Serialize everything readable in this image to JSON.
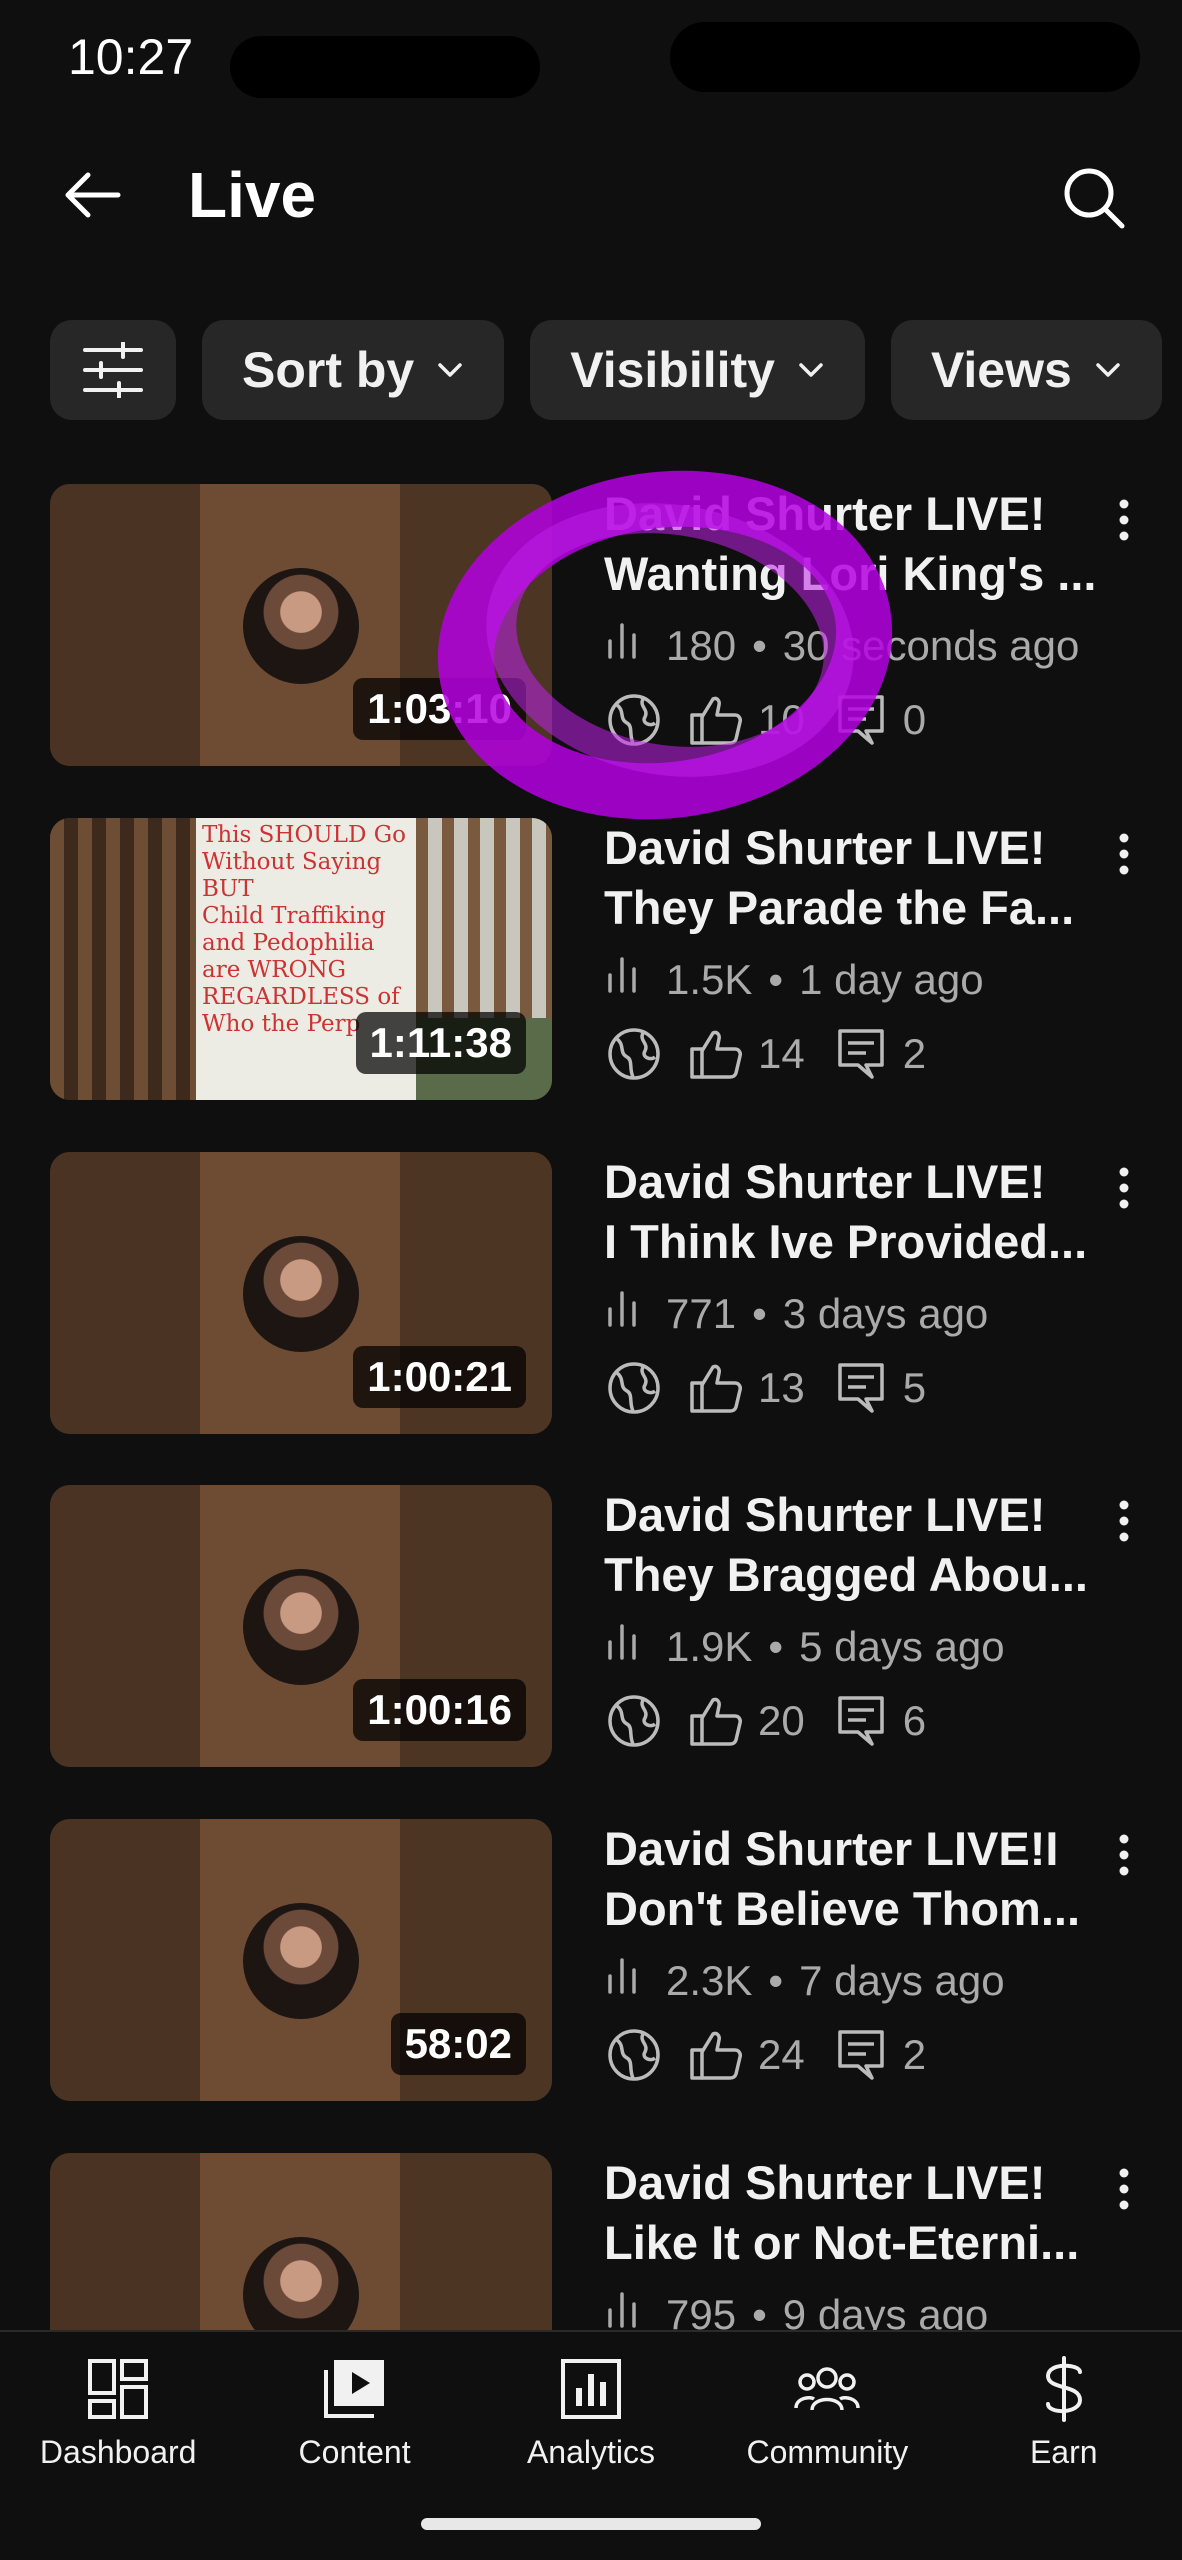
{
  "status_bar": {
    "time": "10:27"
  },
  "header": {
    "title": "Live",
    "back_icon": "arrow-left-icon",
    "search_icon": "search-icon"
  },
  "chips": [
    {
      "icon": "filter-sliders-icon"
    },
    {
      "label": "Sort by"
    },
    {
      "label": "Visibility"
    },
    {
      "label": "Views"
    }
  ],
  "videos": [
    {
      "title1": "David Shurter LIVE!",
      "title2": "Wanting Lori King's ...",
      "views": "180",
      "age": "30 seconds ago",
      "likes": "10",
      "comments": "0",
      "duration": "1:03:10"
    },
    {
      "title1": "David Shurter LIVE!",
      "title2": "They Parade the Fa...",
      "views": "1.5K",
      "age": "1 day ago",
      "likes": "14",
      "comments": "2",
      "duration": "1:11:38",
      "thumbnail_sign": [
        "This SHOULD Go",
        "Without Saying BUT",
        "Child Traffiking",
        "and Pedophilia",
        "are WRONG",
        "REGARDLESS of",
        "Who the Perp"
      ]
    },
    {
      "title1": "David Shurter LIVE!",
      "title2": "I Think Ive Provided...",
      "views": "771",
      "age": "3 days ago",
      "likes": "13",
      "comments": "5",
      "duration": "1:00:21"
    },
    {
      "title1": "David Shurter LIVE!",
      "title2": "They Bragged Abou...",
      "views": "1.9K",
      "age": "5 days ago",
      "likes": "20",
      "comments": "6",
      "duration": "1:00:16"
    },
    {
      "title1": "David Shurter LIVE!I",
      "title2": "Don't Believe Thom...",
      "views": "2.3K",
      "age": "7 days ago",
      "likes": "24",
      "comments": "2",
      "duration": "58:02"
    },
    {
      "title1": "David Shurter LIVE!",
      "title2": "Like It or Not-Eterni...",
      "views": "795",
      "age": "9 days ago"
    }
  ],
  "meta_separator": "•",
  "bottom_nav": [
    {
      "label": "Dashboard",
      "icon": "dashboard-icon"
    },
    {
      "label": "Content",
      "icon": "content-play-icon"
    },
    {
      "label": "Analytics",
      "icon": "analytics-icon"
    },
    {
      "label": "Community",
      "icon": "community-icon"
    },
    {
      "label": "Earn",
      "icon": "dollar-icon"
    }
  ],
  "colors": {
    "background": "#0f0f0f",
    "chip": "#272727",
    "annotation": "#b400e0"
  }
}
